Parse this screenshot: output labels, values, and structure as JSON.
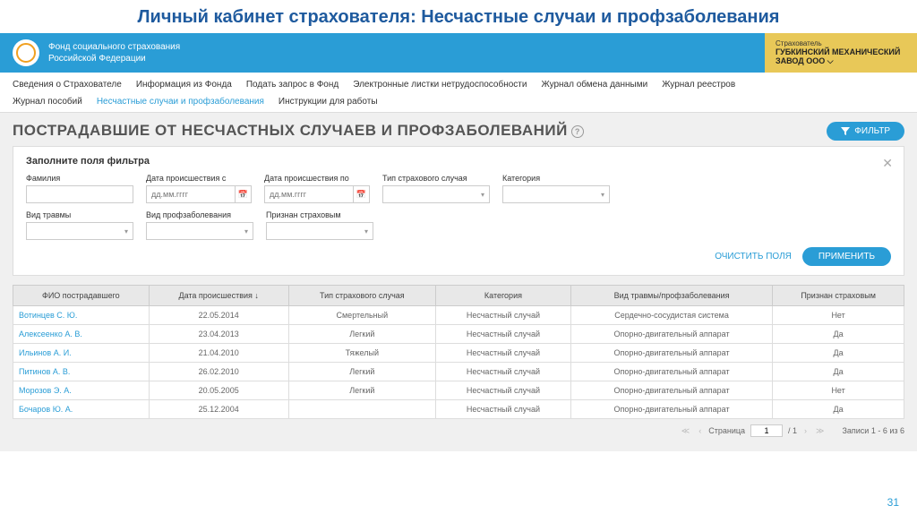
{
  "slide_title": "Личный кабинет страхователя: Несчастные случаи и профзаболевания",
  "header": {
    "org_line1": "Фонд социального страхования",
    "org_line2": "Российской Федерации",
    "user_label": "Страхователь",
    "user_name": "ГУБКИНСКИЙ МЕХАНИЧЕСКИЙ ЗАВОД ООО ⌵"
  },
  "nav": {
    "row1": [
      "Сведения о Страхователе",
      "Информация из Фонда",
      "Подать запрос в Фонд",
      "Электронные листки нетрудоспособности",
      "Журнал обмена данными",
      "Журнал реестров"
    ],
    "row2_a": "Журнал пособий",
    "row2_active": "Несчастные случаи и профзаболевания",
    "row2_b": "Инструкции для работы"
  },
  "page": {
    "title": "ПОСТРАДАВШИЕ ОТ НЕСЧАСТНЫХ СЛУЧАЕВ И ПРОФЗАБОЛЕВАНИЙ",
    "filter_btn": "ФИЛЬТР"
  },
  "filter": {
    "title": "Заполните поля фильтра",
    "labels": {
      "surname": "Фамилия",
      "date_from": "Дата происшествия с",
      "date_to": "Дата происшествия по",
      "case_type": "Тип страхового случая",
      "category": "Категория",
      "injury_type": "Вид травмы",
      "occ_disease": "Вид профзаболевания",
      "is_insured": "Признан страховым"
    },
    "date_ph": "дд.мм.гггг",
    "clear": "ОЧИСТИТЬ ПОЛЯ",
    "apply": "ПРИМЕНИТЬ"
  },
  "table": {
    "headers": [
      "ФИО пострадавшего",
      "Дата происшествия ↓",
      "Тип страхового случая",
      "Категория",
      "Вид травмы/профзаболевания",
      "Признан страховым"
    ],
    "rows": [
      {
        "name": "Вотинцев С. Ю.",
        "date": "22.05.2014",
        "type": "Смертельный",
        "cat": "Несчастный случай",
        "kind": "Сердечно-сосудистая система",
        "ins": "Нет"
      },
      {
        "name": "Алексеенко А. В.",
        "date": "23.04.2013",
        "type": "Легкий",
        "cat": "Несчастный случай",
        "kind": "Опорно-двигательный аппарат",
        "ins": "Да"
      },
      {
        "name": "Ильинов А. И.",
        "date": "21.04.2010",
        "type": "Тяжелый",
        "cat": "Несчастный случай",
        "kind": "Опорно-двигательный аппарат",
        "ins": "Да"
      },
      {
        "name": "Питинов А. В.",
        "date": "26.02.2010",
        "type": "Легкий",
        "cat": "Несчастный случай",
        "kind": "Опорно-двигательный аппарат",
        "ins": "Да"
      },
      {
        "name": "Морозов Э. А.",
        "date": "20.05.2005",
        "type": "Легкий",
        "cat": "Несчастный случай",
        "kind": "Опорно-двигательный аппарат",
        "ins": "Нет"
      },
      {
        "name": "Бочаров Ю. А.",
        "date": "25.12.2004",
        "type": "",
        "cat": "Несчастный случай",
        "kind": "Опорно-двигательный аппарат",
        "ins": "Да"
      }
    ]
  },
  "pager": {
    "page_label": "Страница",
    "page": "1",
    "total": "/ 1",
    "records": "Записи 1 - 6 из 6"
  },
  "slide_number": "31"
}
